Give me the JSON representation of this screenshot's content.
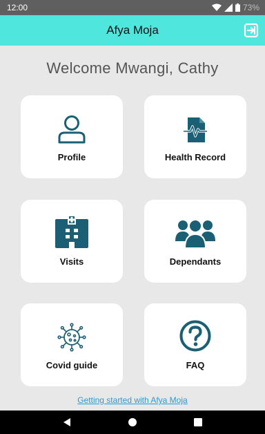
{
  "status_bar": {
    "time": "12:00",
    "battery": "73%"
  },
  "app_bar": {
    "title": "Afya Moja",
    "logout_icon": "logout-icon"
  },
  "welcome": "Welcome Mwangi, Cathy",
  "tiles": [
    {
      "label": "Profile",
      "icon": "person-icon"
    },
    {
      "label": "Health Record",
      "icon": "health-record-icon"
    },
    {
      "label": "Visits",
      "icon": "hospital-icon"
    },
    {
      "label": "Dependants",
      "icon": "group-icon"
    },
    {
      "label": "Covid guide",
      "icon": "virus-icon"
    },
    {
      "label": "FAQ",
      "icon": "question-icon"
    }
  ],
  "footer_link": "Getting started with Afya Moja",
  "colors": {
    "accent": "#4ee6dd",
    "icon": "#1a5f73",
    "link": "#2a9ad6"
  }
}
